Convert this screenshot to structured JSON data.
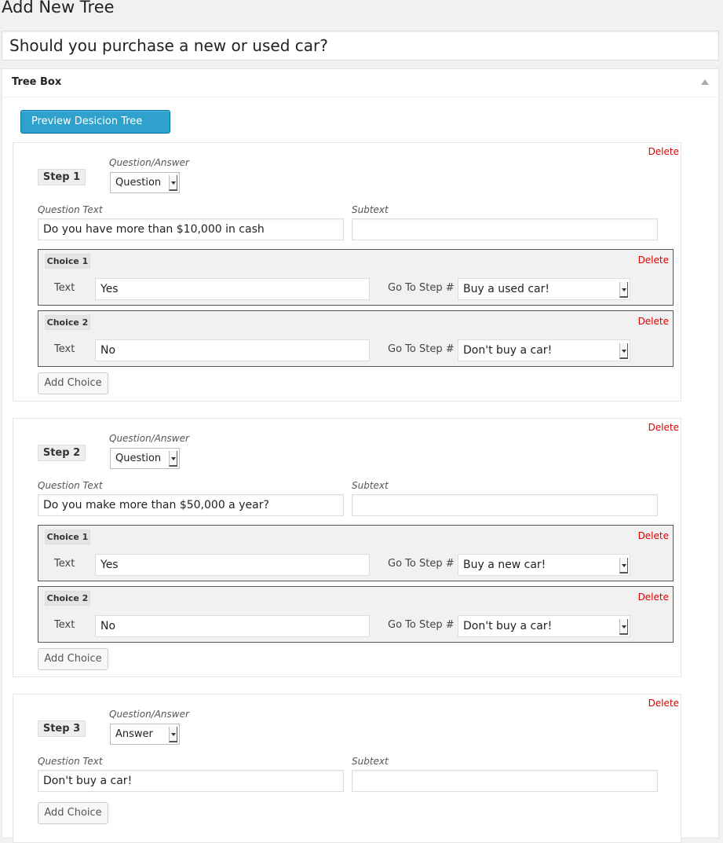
{
  "page": {
    "title": "Add New Tree",
    "tree_title": "Should you purchase a new or used car?"
  },
  "box": {
    "title": "Tree Box",
    "preview_label": "Preview Desicion Tree",
    "toggle_icon": "caret-up-icon"
  },
  "labels": {
    "delete": "Delete",
    "question_answer": "Question/Answer",
    "question_text": "Question Text",
    "subtext": "Subtext",
    "text": "Text",
    "go_to_step": "Go To Step #",
    "add_choice": "Add Choice"
  },
  "colors": {
    "accent": "#2ea2cc",
    "delete": "#dd0000"
  },
  "steps": [
    {
      "label": "Step 1",
      "type": "Question",
      "question_text": "Do you have more than $10,000 in cash",
      "subtext": "",
      "choices": [
        {
          "label": "Choice 1",
          "text": "Yes",
          "goto": "Buy a used car!"
        },
        {
          "label": "Choice 2",
          "text": "No",
          "goto": "Don't buy a car!"
        }
      ]
    },
    {
      "label": "Step 2",
      "type": "Question",
      "question_text": "Do you make more than $50,000 a year?",
      "subtext": "",
      "choices": [
        {
          "label": "Choice 1",
          "text": "Yes",
          "goto": "Buy a new car!"
        },
        {
          "label": "Choice 2",
          "text": "No",
          "goto": "Don't buy a car!"
        }
      ]
    },
    {
      "label": "Step 3",
      "type": "Answer",
      "question_text": "Don't buy a car!",
      "subtext": "",
      "choices": []
    }
  ]
}
